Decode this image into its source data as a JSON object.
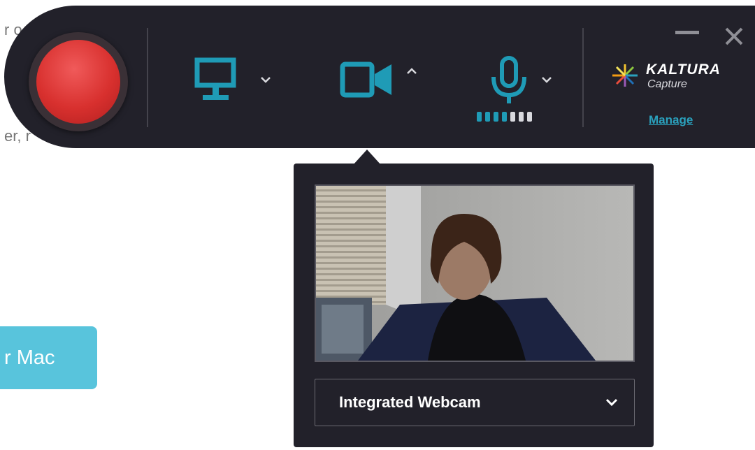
{
  "background": {
    "top_fragment": "r o",
    "mid_fragment": "er, r",
    "mac_button_label": "r Mac"
  },
  "recorder": {
    "accent_color": "#1f9bb6",
    "record_color": "#d8302e",
    "icons": {
      "screen": "monitor-icon",
      "camera": "video-camera-icon",
      "mic": "microphone-icon"
    },
    "mic_level": 0.5,
    "mic_level_segments": 7
  },
  "brand": {
    "name": "KALTURA",
    "sub": "Capture",
    "manage_label": "Manage"
  },
  "camera_popover": {
    "selected_camera": "Integrated Webcam"
  }
}
